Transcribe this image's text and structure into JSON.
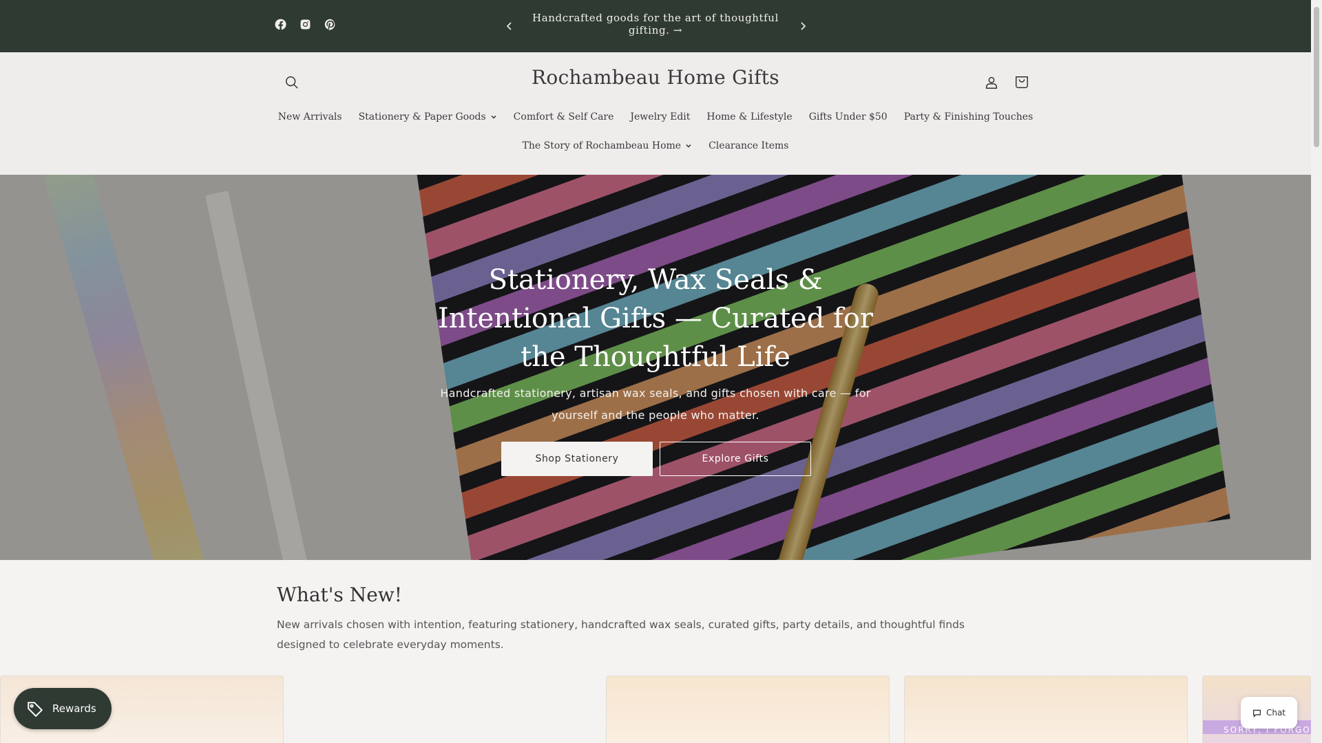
{
  "announcement": {
    "text": "Handcrafted goods for the art of thoughtful gifting. →"
  },
  "social": [
    "facebook-icon",
    "instagram-icon",
    "pinterest-icon"
  ],
  "header": {
    "logo": "Rochambeau Home Gifts"
  },
  "nav": {
    "row1": [
      {
        "label": "New Arrivals",
        "dropdown": false
      },
      {
        "label": "Stationery & Paper Goods",
        "dropdown": true
      },
      {
        "label": "Comfort & Self Care",
        "dropdown": false
      },
      {
        "label": "Jewelry Edit",
        "dropdown": false
      },
      {
        "label": "Home & Lifestyle",
        "dropdown": false
      },
      {
        "label": "Gifts Under $50",
        "dropdown": false
      },
      {
        "label": "Party & Finishing Touches",
        "dropdown": false
      }
    ],
    "row2": [
      {
        "label": "The Story of Rochambeau Home",
        "dropdown": true
      },
      {
        "label": "Clearance Items",
        "dropdown": false
      }
    ]
  },
  "hero": {
    "title": "Stationery, Wax Seals & Intentional Gifts — Curated for the Thoughtful Life",
    "subtitle": "Handcrafted stationery, artisan wax seals, and gifts chosen with care — for yourself and the people who matter.",
    "primary_button": "Shop Stationery",
    "secondary_button": "Explore Gifts"
  },
  "whats_new": {
    "title": "What's New!",
    "description": "New arrivals chosen with intention, featuring stationery, handcrafted wax seals, curated gifts, party details, and thoughtful finds designed to celebrate everyday moments.",
    "partial_banner": "SORRY, I FORGOT"
  },
  "widgets": {
    "rewards_label": "Rewards",
    "chat_label": "Chat"
  },
  "colors": {
    "announcement_bg": "#2f3a33",
    "page_bg": "#efecec",
    "text": "#333333"
  }
}
